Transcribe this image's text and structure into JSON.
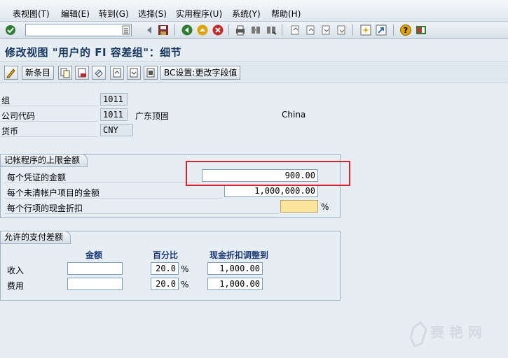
{
  "menu": [
    "表视图(T)",
    "编辑(E)",
    "转到(G)",
    "选择(S)",
    "实用程序(U)",
    "系统(Y)",
    "帮助(H)"
  ],
  "command_field": {
    "value": ""
  },
  "title": "修改视图 \"用户的 FI 容差组\"：细节",
  "app_toolbar": {
    "new_entries": "新条目",
    "bc_set": "BC设置:更改字段值"
  },
  "header": {
    "group": {
      "label": "组",
      "value": "1011"
    },
    "company_code": {
      "label": "公司代码",
      "value": "1011",
      "name": "广东顶固",
      "country": "China"
    },
    "currency": {
      "label": "货币",
      "value": "CNY"
    }
  },
  "upper_limits": {
    "title": "记帐程序的上限金额",
    "rows": [
      {
        "label": "每个凭证的金额",
        "value": "900.00"
      },
      {
        "label": "每个未清帐户项目的金额",
        "value": "1,000,000.00"
      },
      {
        "label": "每个行项的现金折扣",
        "value": "",
        "unit": "%"
      }
    ]
  },
  "payment_diff": {
    "title": "允许的支付差额",
    "columns": [
      "金额",
      "百分比",
      "现金折扣调整到"
    ],
    "rows": [
      {
        "label": "收入",
        "amount": "",
        "percent": "20.0",
        "unit": "%",
        "adjust": "1,000.00"
      },
      {
        "label": "费用",
        "amount": "",
        "percent": "20.0",
        "unit": "%",
        "adjust": "1,000.00"
      }
    ]
  },
  "watermark": {
    "text": "赛 艳 网"
  },
  "colors": {
    "highlight": "#d9222a",
    "required_field": "#fbe59a",
    "background": "#e6edf3"
  }
}
